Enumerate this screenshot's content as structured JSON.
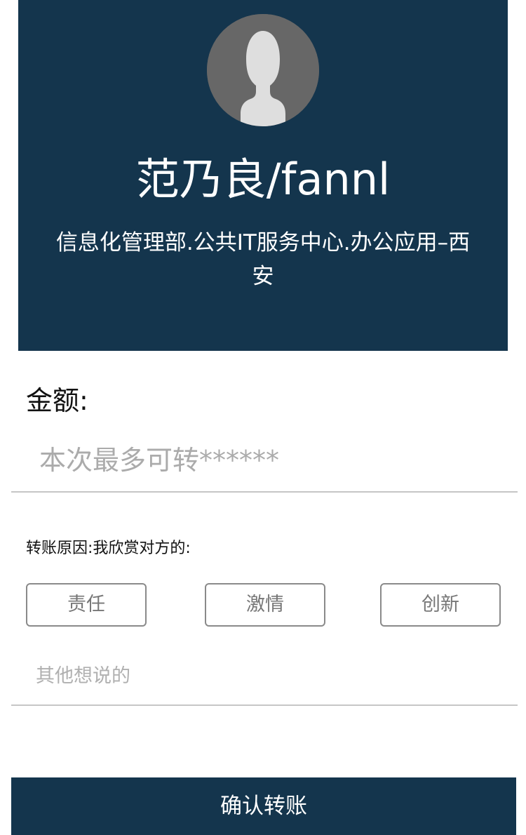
{
  "profile": {
    "name": "范乃良/fannl",
    "department": "信息化管理部.公共IT服务中心.办公应用–西安",
    "avatar_icon": "user-silhouette-icon"
  },
  "amount": {
    "label": "金额:",
    "placeholder": "本次最多可转******"
  },
  "reason": {
    "label": "转账原因:我欣赏对方的:",
    "tags": [
      "责任",
      "激情",
      "创新"
    ]
  },
  "comment": {
    "placeholder": "其他想说的"
  },
  "confirm": {
    "label": "确认转账"
  },
  "colors": {
    "primary": "#14354d",
    "tag_border": "#8a8a8a",
    "placeholder": "#ababab"
  }
}
